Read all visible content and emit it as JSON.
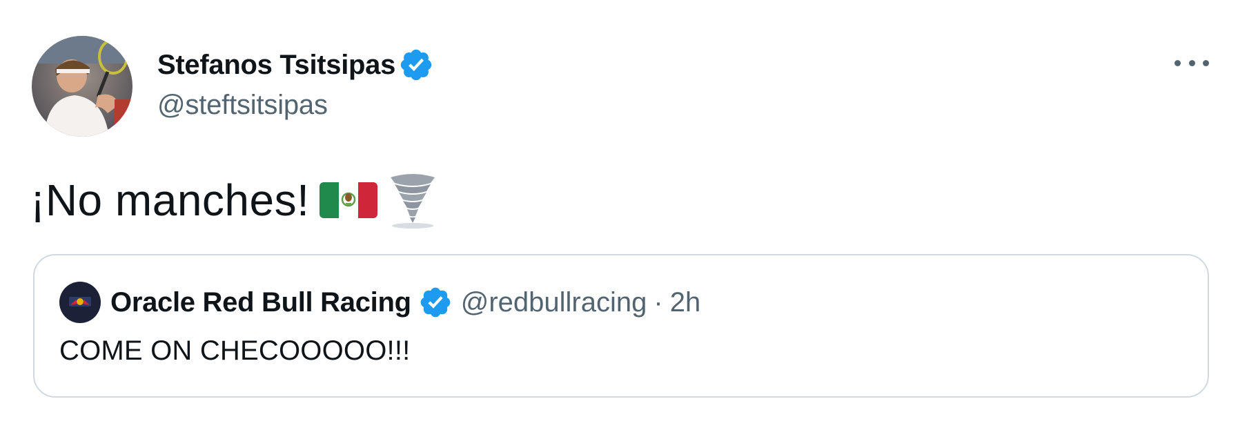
{
  "tweet": {
    "author": {
      "name": "Stefanos Tsitsipas",
      "handle": "@steftsitsipas",
      "verified": true
    },
    "text": "¡No manches!",
    "emojis": [
      "mexico-flag-icon",
      "tornado-icon"
    ],
    "quoted_tweet": {
      "author": {
        "name": "Oracle Red Bull Racing",
        "handle": "@redbullracing",
        "verified": true
      },
      "separator": "·",
      "time": "2h",
      "text": "COME ON CHECOOOOO!!!"
    }
  },
  "colors": {
    "verified_blue": "#1d9bf0",
    "text_primary": "#0f1419",
    "text_secondary": "#536471",
    "border": "#cfd9de"
  }
}
